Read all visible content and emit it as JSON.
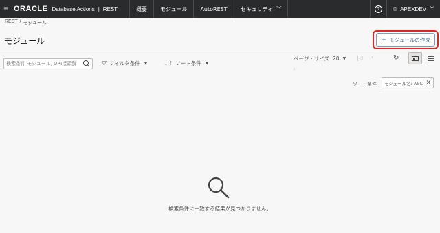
{
  "topbar": {
    "menu_icon": "hamburger-icon",
    "logo": "ORACLE",
    "product": "Database Actions",
    "separator": "|",
    "section": "REST",
    "nav": [
      {
        "label": "概要"
      },
      {
        "label": "モジュール"
      },
      {
        "label": "AutoREST"
      },
      {
        "label": "セキュリティ",
        "chevron": "chevron-down-icon"
      }
    ],
    "help_glyph": "?",
    "user_label": "APEXDEV"
  },
  "breadcrumb": {
    "root": "REST",
    "separator": "/",
    "current": "モジュール"
  },
  "page": {
    "title": "モジュール",
    "create_button": "モジュールの作成",
    "highlight_color": "#e0261f"
  },
  "toolbar": {
    "search_placeholder": "検索条件 モジュール, URI接頭辞",
    "filter_label": "フィルタ条件",
    "sort_label": "ソート条件",
    "page_size_label": "ページ・サイズ: 20",
    "sort_criteria_label": "ソート条件",
    "sort_chip": "モジュール名: ASC"
  },
  "empty_state": {
    "icon": "search-icon",
    "message": "検索条件に一致する結果が見つかりません。"
  }
}
